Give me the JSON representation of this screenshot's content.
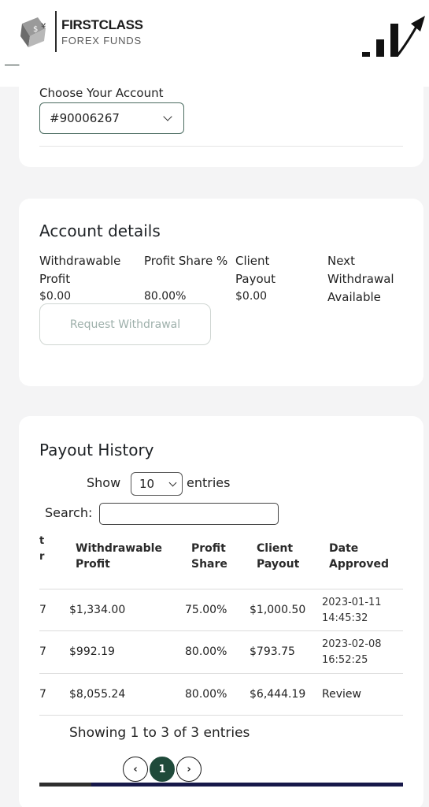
{
  "brand": {
    "name_top": "FIRSTCLASS",
    "name_bottom": "FOREX FUNDS"
  },
  "colors": {
    "accent": "#1f4a3a",
    "border": "#4b6c61",
    "scrollbar": "#17194a"
  },
  "account_select": {
    "label": "Choose Your Account",
    "value": "#90006267"
  },
  "account_details": {
    "title": "Account details",
    "fields": [
      {
        "label": "Withdrawable Profit",
        "value": "$0.00"
      },
      {
        "label": "Profit Share %",
        "value": "80.00%"
      },
      {
        "label": "Client Payout",
        "value": "$0.00"
      },
      {
        "label": "Next Withdrawal Available",
        "value": ""
      }
    ],
    "button": "Request Withdrawal"
  },
  "payout_history": {
    "title": "Payout History",
    "show_label": "Show",
    "entries_value": "10",
    "entries_label": "entries",
    "search_label": "Search:",
    "columns": [
      "t r",
      "Withdrawable Profit",
      "Profit Share",
      "Client Payout",
      "Date Approved"
    ],
    "rows": [
      {
        "id": "7",
        "profit": "$1,334.00",
        "share": "75.00%",
        "payout": "$1,000.50",
        "date": "2023-01-11 14:45:32"
      },
      {
        "id": "7",
        "profit": "$992.19",
        "share": "80.00%",
        "payout": "$793.75",
        "date": "2023-02-08 16:52:25"
      },
      {
        "id": "7",
        "profit": "$8,055.24",
        "share": "80.00%",
        "payout": "$6,444.19",
        "date": "Review"
      }
    ],
    "info": "Showing 1 to 3 of 3 entries",
    "pagination": {
      "prev": "‹",
      "current": "1",
      "next": "›"
    }
  }
}
